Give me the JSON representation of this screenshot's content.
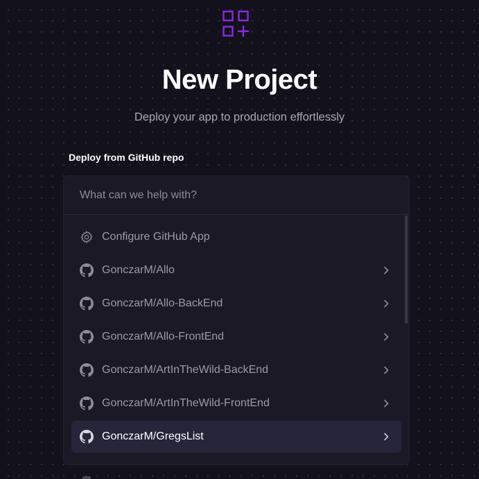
{
  "header": {
    "logo_icon": "new-project-grid-plus-icon",
    "logo_color": "#8a2be2",
    "title": "New Project",
    "subtitle": "Deploy your app to production effortlessly"
  },
  "deploy": {
    "section_label": "Deploy from GitHub repo",
    "search": {
      "placeholder": "What can we help with?",
      "value": ""
    },
    "items": [
      {
        "label": "Configure GitHub App",
        "icon": "gear-icon",
        "has_chevron": false,
        "selected": false
      },
      {
        "label": "GonczarM/Allo",
        "icon": "github-icon",
        "has_chevron": true,
        "selected": false
      },
      {
        "label": "GonczarM/Allo-BackEnd",
        "icon": "github-icon",
        "has_chevron": true,
        "selected": false
      },
      {
        "label": "GonczarM/Allo-FrontEnd",
        "icon": "github-icon",
        "has_chevron": true,
        "selected": false
      },
      {
        "label": "GonczarM/ArtInTheWild-BackEnd",
        "icon": "github-icon",
        "has_chevron": true,
        "selected": false
      },
      {
        "label": "GonczarM/ArtInTheWild-FrontEnd",
        "icon": "github-icon",
        "has_chevron": true,
        "selected": false
      },
      {
        "label": "GonczarM/GregsList",
        "icon": "github-icon",
        "has_chevron": true,
        "selected": true
      }
    ]
  },
  "colors": {
    "background": "#13111c",
    "panel": "#1b1925",
    "selected_row": "#27253a",
    "accent": "#8a2be2"
  }
}
